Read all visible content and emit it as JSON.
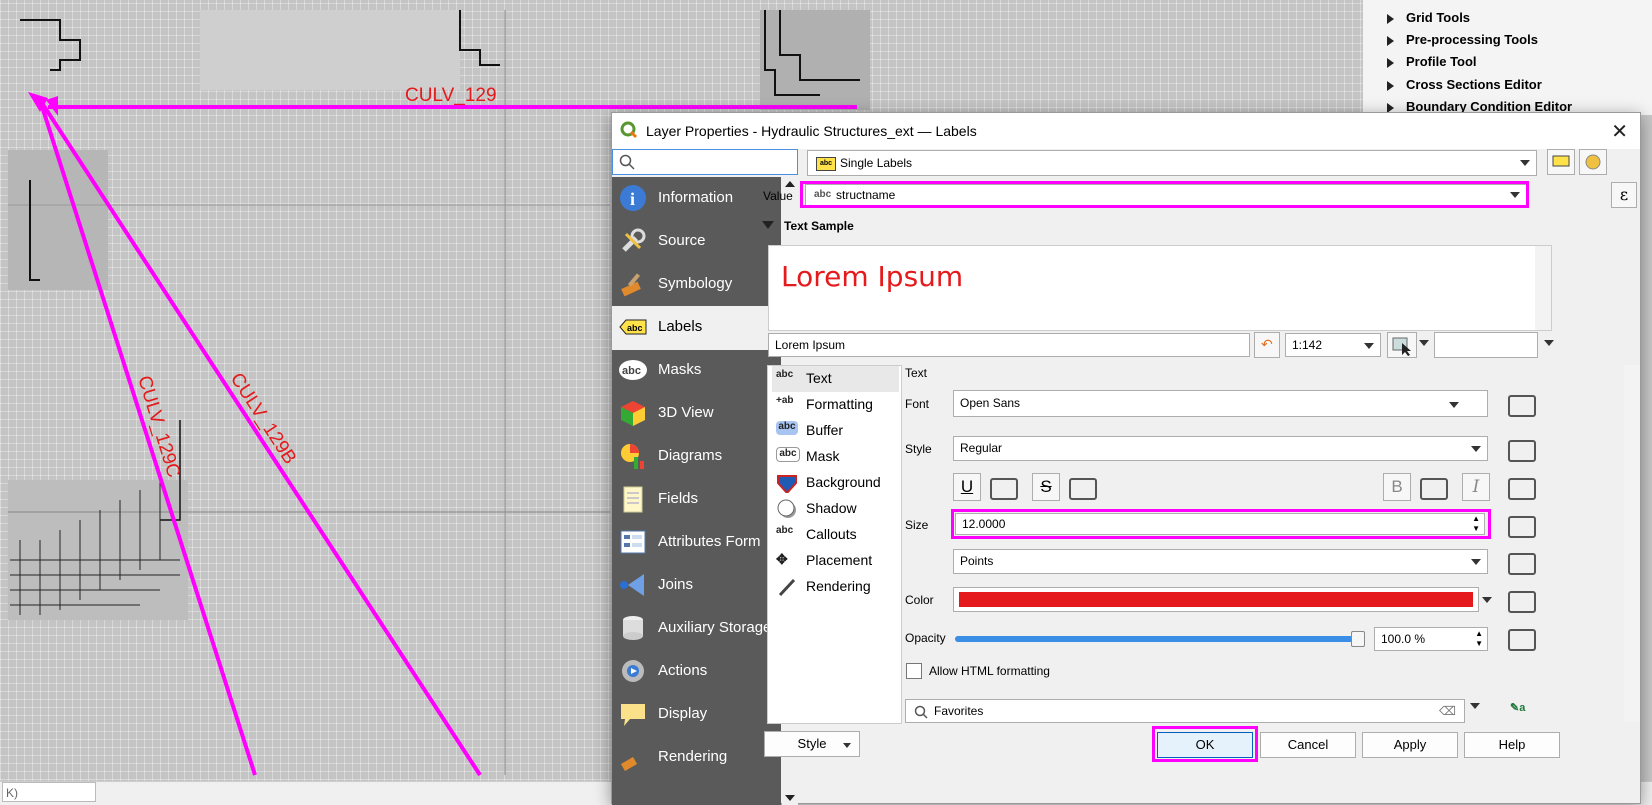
{
  "map": {
    "labels": [
      "CULV_129",
      "CULV_129C",
      "CULV_129B"
    ]
  },
  "toolbox": {
    "items": [
      "Grid Tools",
      "Pre-processing Tools",
      "Profile Tool",
      "Cross Sections Editor",
      "Boundary Condition Editor"
    ]
  },
  "statusbar": {
    "locator_placeholder": "K)"
  },
  "dialog": {
    "title": "Layer Properties - Hydraulic Structures_ext — Labels",
    "nav": [
      "Information",
      "Source",
      "Symbology",
      "Labels",
      "Masks",
      "3D View",
      "Diagrams",
      "Fields",
      "Attributes Form",
      "Joins",
      "Auxiliary Storage",
      "Actions",
      "Display",
      "Rendering"
    ],
    "active_nav": "Labels",
    "mode": "Single Labels",
    "value_label": "Value",
    "value_field": "structname",
    "value_field_prefix": "abc",
    "text_sample_header": "Text Sample",
    "sample_text": "Lorem Ipsum",
    "sample_input": "Lorem Ipsum",
    "scale": "1:142",
    "sub_tabs": [
      "Text",
      "Formatting",
      "Buffer",
      "Mask",
      "Background",
      "Shadow",
      "Callouts",
      "Placement",
      "Rendering"
    ],
    "section_title": "Text",
    "font_label": "Font",
    "font_value": "Open Sans",
    "style_label": "Style",
    "style_value": "Regular",
    "size_label": "Size",
    "size_value": "12.0000",
    "unit_value": "Points",
    "color_label": "Color",
    "color_value": "#e41a1c",
    "opacity_label": "Opacity",
    "opacity_value": "100.0 %",
    "opacity_fraction": 1.0,
    "allow_html_label": "Allow HTML formatting",
    "favorites_placeholder": "Favorites",
    "buttons": {
      "style": "Style",
      "ok": "OK",
      "cancel": "Cancel",
      "apply": "Apply",
      "help": "Help"
    },
    "underline_glyph": "U",
    "strike_glyph": "S",
    "bold_glyph": "B",
    "italic_glyph": "I"
  },
  "colors": {
    "highlight": "#ff00ff",
    "label_red": "#e41a1c",
    "nav_bg": "#5a5a5a"
  }
}
